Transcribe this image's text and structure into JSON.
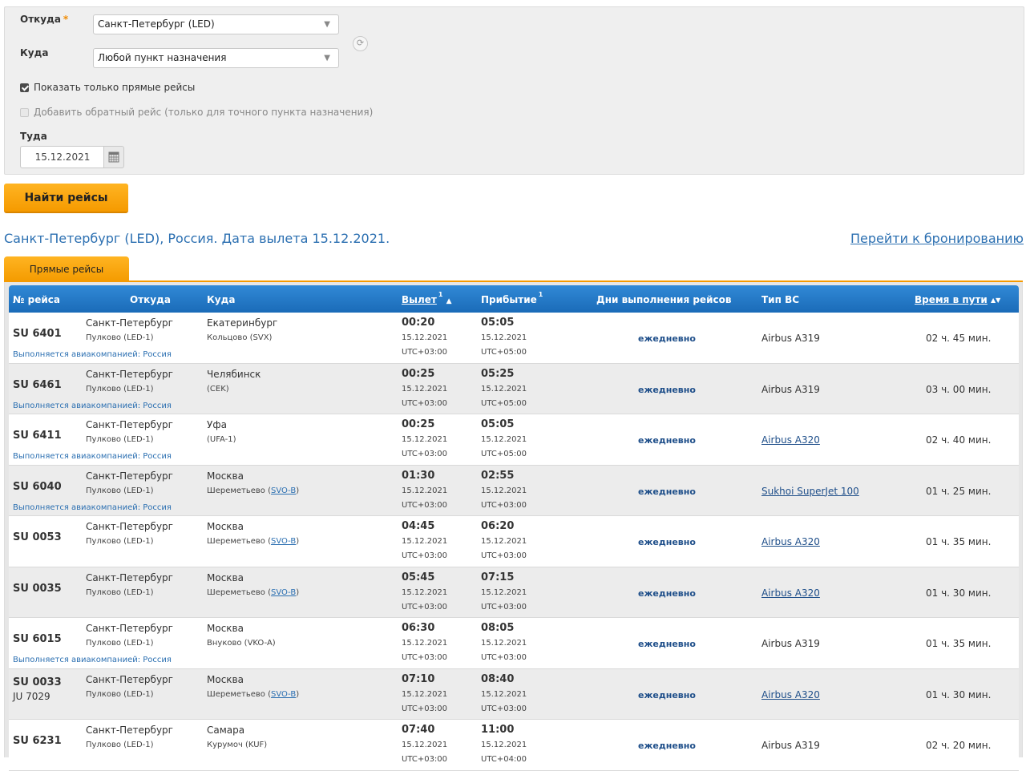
{
  "form": {
    "from_label": "Откуда",
    "required_mark": "*",
    "from_value": "Санкт-Петербург (LED)",
    "to_label": "Куда",
    "to_value": "Любой пункт назначения",
    "direct_only_label": "Показать только прямые рейсы",
    "direct_only_checked": true,
    "return_label": "Добавить обратный рейс (только для точного пункта назначения)",
    "return_checked": false,
    "date_label": "Туда",
    "date_value": "15.12.2021",
    "search_button": "Найти рейсы"
  },
  "results": {
    "title": "Санкт-Петербург (LED), Россия. Дата вылета 15.12.2021.",
    "booking_link": "Перейти к бронированию",
    "tab_direct": "Прямые рейсы"
  },
  "table": {
    "headers": {
      "flight_no": "№ рейса",
      "from": "Откуда",
      "to": "Куда",
      "departure": "Вылет",
      "departure_sup": "1",
      "departure_sort": "▲",
      "arrival": "Прибытие",
      "arrival_sup": "1",
      "days": "Дни выполнения рейсов",
      "aircraft": "Тип ВС",
      "duration": "Время в пути",
      "duration_sort": "▲▼"
    },
    "rows": [
      {
        "flight": "SU 6401",
        "flight2": "",
        "operated": "Выполняется авиакомпанией: Россия",
        "from_city": "Санкт-Петербург",
        "from_airport": "Пулково (LED-1)",
        "to_city": "Екатеринбург",
        "to_airport": "Кольцово (SVX)",
        "to_airport_link": "",
        "dep_time": "00:20",
        "dep_date": "15.12.2021",
        "dep_tz": "UTC+03:00",
        "arr_time": "05:05",
        "arr_date": "15.12.2021",
        "arr_tz": "UTC+05:00",
        "days": "ежедневно",
        "aircraft": "Airbus A319",
        "aircraft_link": false,
        "duration": "02 ч. 45 мин."
      },
      {
        "flight": "SU 6461",
        "flight2": "",
        "operated": "Выполняется авиакомпанией: Россия",
        "from_city": "Санкт-Петербург",
        "from_airport": "Пулково (LED-1)",
        "to_city": "Челябинск",
        "to_airport": "(CEK)",
        "to_airport_link": "",
        "dep_time": "00:25",
        "dep_date": "15.12.2021",
        "dep_tz": "UTC+03:00",
        "arr_time": "05:25",
        "arr_date": "15.12.2021",
        "arr_tz": "UTC+05:00",
        "days": "ежедневно",
        "aircraft": "Airbus A319",
        "aircraft_link": false,
        "duration": "03 ч. 00 мин."
      },
      {
        "flight": "SU 6411",
        "flight2": "",
        "operated": "Выполняется авиакомпанией: Россия",
        "from_city": "Санкт-Петербург",
        "from_airport": "Пулково (LED-1)",
        "to_city": "Уфа",
        "to_airport": "(UFA-1)",
        "to_airport_link": "",
        "dep_time": "00:25",
        "dep_date": "15.12.2021",
        "dep_tz": "UTC+03:00",
        "arr_time": "05:05",
        "arr_date": "15.12.2021",
        "arr_tz": "UTC+05:00",
        "days": "ежедневно",
        "aircraft": "Airbus A320",
        "aircraft_link": true,
        "duration": "02 ч. 40 мин."
      },
      {
        "flight": "SU 6040",
        "flight2": "",
        "operated": "Выполняется авиакомпанией: Россия",
        "from_city": "Санкт-Петербург",
        "from_airport": "Пулково (LED-1)",
        "to_city": "Москва",
        "to_airport": "Шереметьево (",
        "to_airport_link": "SVO-B",
        "dep_time": "01:30",
        "dep_date": "15.12.2021",
        "dep_tz": "UTC+03:00",
        "arr_time": "02:55",
        "arr_date": "15.12.2021",
        "arr_tz": "UTC+03:00",
        "days": "ежедневно",
        "aircraft": "Sukhoi SuperJet 100",
        "aircraft_link": true,
        "duration": "01 ч. 25 мин."
      },
      {
        "flight": "SU 0053",
        "flight2": "",
        "operated": "",
        "from_city": "Санкт-Петербург",
        "from_airport": "Пулково (LED-1)",
        "to_city": "Москва",
        "to_airport": "Шереметьево (",
        "to_airport_link": "SVO-B",
        "dep_time": "04:45",
        "dep_date": "15.12.2021",
        "dep_tz": "UTC+03:00",
        "arr_time": "06:20",
        "arr_date": "15.12.2021",
        "arr_tz": "UTC+03:00",
        "days": "ежедневно",
        "aircraft": "Airbus A320",
        "aircraft_link": true,
        "duration": "01 ч. 35 мин."
      },
      {
        "flight": "SU 0035",
        "flight2": "",
        "operated": "",
        "from_city": "Санкт-Петербург",
        "from_airport": "Пулково (LED-1)",
        "to_city": "Москва",
        "to_airport": "Шереметьево (",
        "to_airport_link": "SVO-B",
        "dep_time": "05:45",
        "dep_date": "15.12.2021",
        "dep_tz": "UTC+03:00",
        "arr_time": "07:15",
        "arr_date": "15.12.2021",
        "arr_tz": "UTC+03:00",
        "days": "ежедневно",
        "aircraft": "Airbus A320",
        "aircraft_link": true,
        "duration": "01 ч. 30 мин."
      },
      {
        "flight": "SU 6015",
        "flight2": "",
        "operated": "Выполняется авиакомпанией: Россия",
        "from_city": "Санкт-Петербург",
        "from_airport": "Пулково (LED-1)",
        "to_city": "Москва",
        "to_airport": "Внуково (VKO-A)",
        "to_airport_link": "",
        "dep_time": "06:30",
        "dep_date": "15.12.2021",
        "dep_tz": "UTC+03:00",
        "arr_time": "08:05",
        "arr_date": "15.12.2021",
        "arr_tz": "UTC+03:00",
        "days": "ежедневно",
        "aircraft": "Airbus A319",
        "aircraft_link": false,
        "duration": "01 ч. 35 мин."
      },
      {
        "flight": "SU 0033",
        "flight2": "JU 7029",
        "operated": "",
        "from_city": "Санкт-Петербург",
        "from_airport": "Пулково (LED-1)",
        "to_city": "Москва",
        "to_airport": "Шереметьево (",
        "to_airport_link": "SVO-B",
        "dep_time": "07:10",
        "dep_date": "15.12.2021",
        "dep_tz": "UTC+03:00",
        "arr_time": "08:40",
        "arr_date": "15.12.2021",
        "arr_tz": "UTC+03:00",
        "days": "ежедневно",
        "aircraft": "Airbus A320",
        "aircraft_link": true,
        "duration": "01 ч. 30 мин."
      },
      {
        "flight": "SU 6231",
        "flight2": "",
        "operated": "",
        "from_city": "Санкт-Петербург",
        "from_airport": "Пулково (LED-1)",
        "to_city": "Самара",
        "to_airport": "Курумоч (KUF)",
        "to_airport_link": "",
        "dep_time": "07:40",
        "dep_date": "15.12.2021",
        "dep_tz": "UTC+03:00",
        "arr_time": "11:00",
        "arr_date": "15.12.2021",
        "arr_tz": "UTC+04:00",
        "days": "ежедневно",
        "aircraft": "Airbus A319",
        "aircraft_link": false,
        "duration": "02 ч. 20 мин."
      }
    ]
  }
}
